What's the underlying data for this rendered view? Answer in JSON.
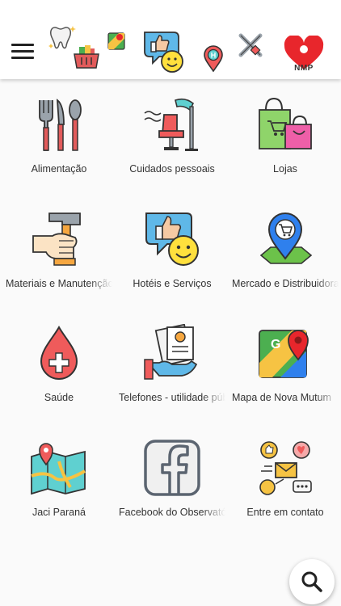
{
  "header": {
    "menu_icon": "hamburger-menu-icon",
    "icons": [
      "tooth-icon",
      "basket-icon",
      "map-pin-icon",
      "thumbs-up-smiley-icon",
      "hotel-pin-icon",
      "tools-icon"
    ],
    "logo_text": "NMP",
    "logo_color": "#e8262c"
  },
  "categories": [
    {
      "label": "Alimentação",
      "icon": "cutlery-icon"
    },
    {
      "label": "Cuidados pessoais",
      "icon": "salon-chair-icon"
    },
    {
      "label": "Lojas",
      "icon": "shopping-bags-icon"
    },
    {
      "label": "Materiais e Manutenção",
      "icon": "hammer-hand-icon"
    },
    {
      "label": "Hotéis e Serviços",
      "icon": "thumbs-up-smiley-icon"
    },
    {
      "label": "Mercado e Distribuidora",
      "icon": "cart-pin-icon"
    },
    {
      "label": "Saúde",
      "icon": "blood-drop-cross-icon"
    },
    {
      "label": "Telefones - utilidade pública",
      "icon": "contact-card-hand-icon"
    },
    {
      "label": "Mapa de Nova Mutum",
      "icon": "google-maps-icon"
    },
    {
      "label": "Jaci Paraná",
      "icon": "folded-map-icon"
    },
    {
      "label": "Facebook do Observatório",
      "icon": "facebook-icon"
    },
    {
      "label": "Entre em contato",
      "icon": "contact-network-icon"
    }
  ],
  "fab": {
    "icon": "search-icon"
  }
}
